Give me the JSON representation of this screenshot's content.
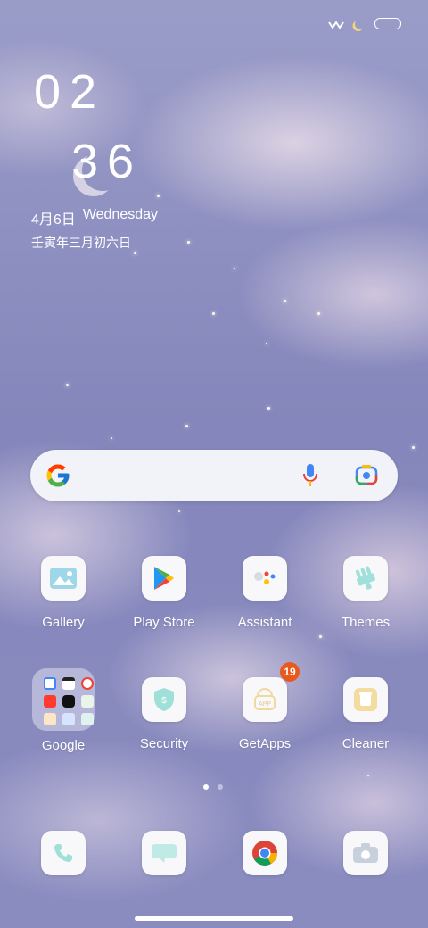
{
  "status_bar": {
    "icons": [
      "wave-icon",
      "moon-icon",
      "battery-icon"
    ]
  },
  "clock": {
    "hour": "02",
    "minute": "36",
    "date": "4月6日",
    "weekday": "Wednesday",
    "lunar_date": "壬寅年三月初六日"
  },
  "search_bar": {
    "icons": [
      "google-g-icon",
      "microphone-icon",
      "google-lens-icon"
    ]
  },
  "apps": [
    {
      "label": "Gallery",
      "icon": "gallery-icon"
    },
    {
      "label": "Play Store",
      "icon": "play-store-icon"
    },
    {
      "label": "Assistant",
      "icon": "assistant-icon"
    },
    {
      "label": "Themes",
      "icon": "themes-icon"
    },
    {
      "label": "Google",
      "icon": "google-folder-icon"
    },
    {
      "label": "Security",
      "icon": "security-shield-icon"
    },
    {
      "label": "GetApps",
      "icon": "getapps-icon",
      "badge": "19"
    },
    {
      "label": "Cleaner",
      "icon": "cleaner-trash-icon"
    }
  ],
  "dock": [
    {
      "icon": "phone-icon"
    },
    {
      "icon": "messages-icon"
    },
    {
      "icon": "chrome-icon"
    },
    {
      "icon": "camera-icon"
    }
  ],
  "pages": {
    "count": 2,
    "current": 1
  },
  "colors": {
    "badge": "#e85a1c",
    "accent_teal": "#9fe0d8",
    "wallpaper": "#8a8cbf"
  }
}
